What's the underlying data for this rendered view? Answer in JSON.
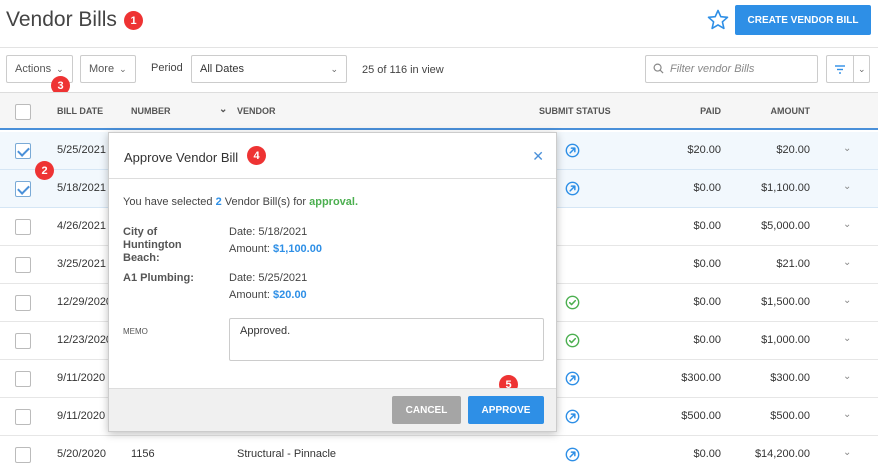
{
  "page": {
    "title": "Vendor Bills",
    "create_button": "CREATE VENDOR BILL"
  },
  "toolbar": {
    "actions_label": "Actions",
    "more_label": "More",
    "period_label": "Period",
    "period_value": "All Dates",
    "in_view": "25 of 116 in view",
    "filter_placeholder": "Filter vendor Bills"
  },
  "table": {
    "columns": [
      "BILL DATE",
      "NUMBER",
      "VENDOR",
      "SUBMIT STATUS",
      "PAID",
      "AMOUNT"
    ],
    "rows": [
      {
        "date": "5/25/2021",
        "number": "",
        "vendor": "",
        "status": "submit",
        "paid": "$20.00",
        "amount": "$20.00",
        "checked": true
      },
      {
        "date": "5/18/2021",
        "number": "",
        "vendor": "",
        "status": "submit",
        "paid": "$0.00",
        "amount": "$1,100.00",
        "checked": true
      },
      {
        "date": "4/26/2021",
        "number": "",
        "vendor": "",
        "status": "",
        "paid": "$0.00",
        "amount": "$5,000.00",
        "checked": false
      },
      {
        "date": "3/25/2021",
        "number": "",
        "vendor": "",
        "status": "",
        "paid": "$0.00",
        "amount": "$21.00",
        "checked": false
      },
      {
        "date": "12/29/2020",
        "number": "",
        "vendor": "",
        "status": "approved",
        "paid": "$0.00",
        "amount": "$1,500.00",
        "checked": false
      },
      {
        "date": "12/23/2020",
        "number": "",
        "vendor": "",
        "status": "approved",
        "paid": "$0.00",
        "amount": "$1,000.00",
        "checked": false
      },
      {
        "date": "9/11/2020",
        "number": "",
        "vendor": "",
        "status": "submit",
        "paid": "$300.00",
        "amount": "$300.00",
        "checked": false
      },
      {
        "date": "9/11/2020",
        "number": "",
        "vendor": "",
        "status": "submit",
        "paid": "$500.00",
        "amount": "$500.00",
        "checked": false
      },
      {
        "date": "5/20/2020",
        "number": "1156",
        "vendor": "Structural - Pinnacle",
        "status": "submit",
        "paid": "$0.00",
        "amount": "$14,200.00",
        "checked": false
      }
    ]
  },
  "modal": {
    "title": "Approve Vendor Bill",
    "msg_prefix": "You have selected ",
    "msg_count": "2",
    "msg_middle": " Vendor Bill(s) for ",
    "msg_action": "approval.",
    "vendors": [
      {
        "name": "City of Huntington Beach:",
        "date": "Date: 5/18/2021",
        "amount_label": "Amount: ",
        "amount": "$1,100.00"
      },
      {
        "name": "A1 Plumbing:",
        "date": "Date: 5/25/2021",
        "amount_label": "Amount: ",
        "amount": "$20.00"
      }
    ],
    "memo_label": "MEMO",
    "memo_value": "Approved.",
    "cancel_label": "CANCEL",
    "approve_label": "APPROVE"
  },
  "badges": {
    "b1": "1",
    "b2": "2",
    "b3": "3",
    "b4": "4",
    "b5": "5"
  },
  "colors": {
    "accent": "#2e8fe6",
    "badge": "#e33",
    "success": "#4caf50"
  }
}
